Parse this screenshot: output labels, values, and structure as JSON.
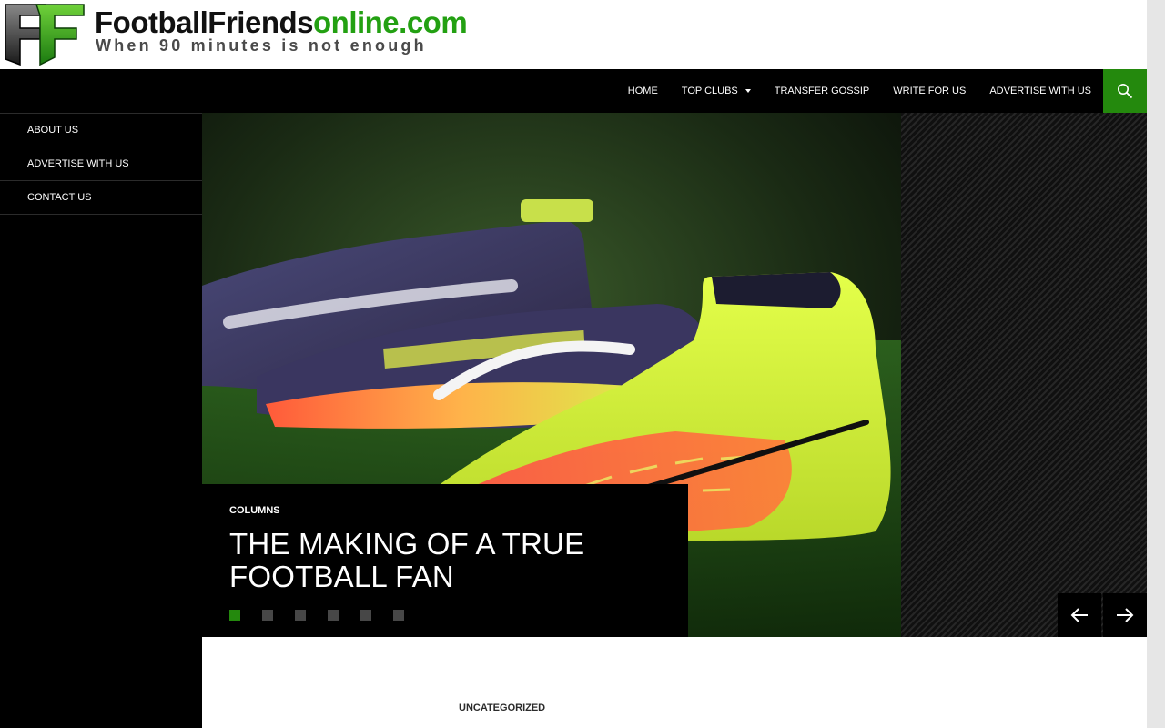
{
  "header": {
    "logo_name_part1": "FootballFriends",
    "logo_name_part2": "online.com",
    "logo_tagline": "When 90 minutes is not enough"
  },
  "nav": {
    "items": [
      {
        "label": "HOME"
      },
      {
        "label": "TOP CLUBS",
        "has_dropdown": true
      },
      {
        "label": "TRANSFER GOSSIP"
      },
      {
        "label": "WRITE FOR US"
      },
      {
        "label": "ADVERTISE WITH US"
      }
    ],
    "search_icon": "search-icon"
  },
  "sidebar": {
    "items": [
      {
        "label": "ABOUT US"
      },
      {
        "label": "ADVERTISE WITH US"
      },
      {
        "label": "CONTACT US"
      }
    ]
  },
  "slider": {
    "category": "COLUMNS",
    "title": "THE MAKING OF A TRUE FOOTBALL FAN",
    "dot_count": 6,
    "active_dot": 1,
    "prev_icon": "arrow-left-icon",
    "next_icon": "arrow-right-icon"
  },
  "content": {
    "post_category": "UNCATEGORIZED"
  },
  "colors": {
    "accent": "#24890d",
    "logo_green": "#23a012",
    "background": "#000000"
  }
}
